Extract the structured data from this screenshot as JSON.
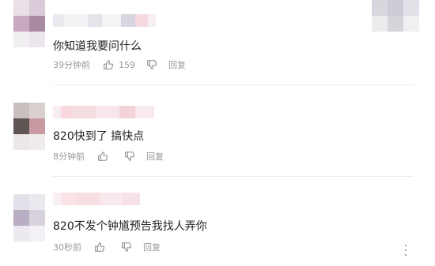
{
  "comments": [
    {
      "text": "你知道我要问什么",
      "time": "39分钟前",
      "like_count": "159",
      "reply_label": "回复"
    },
    {
      "text": "820快到了 搞快点",
      "time": "8分钟前",
      "like_count": "",
      "reply_label": "回复"
    },
    {
      "text": "820不发个钟馗预告我找人弄你",
      "time": "30秒前",
      "like_count": "",
      "reply_label": "回复"
    }
  ],
  "colors": {
    "text_primary": "#222222",
    "text_meta": "#999999",
    "divider": "#ececec"
  },
  "icons": {
    "like": "thumbs-up-icon",
    "dislike": "thumbs-down-icon",
    "more": "more-vertical-icon"
  }
}
